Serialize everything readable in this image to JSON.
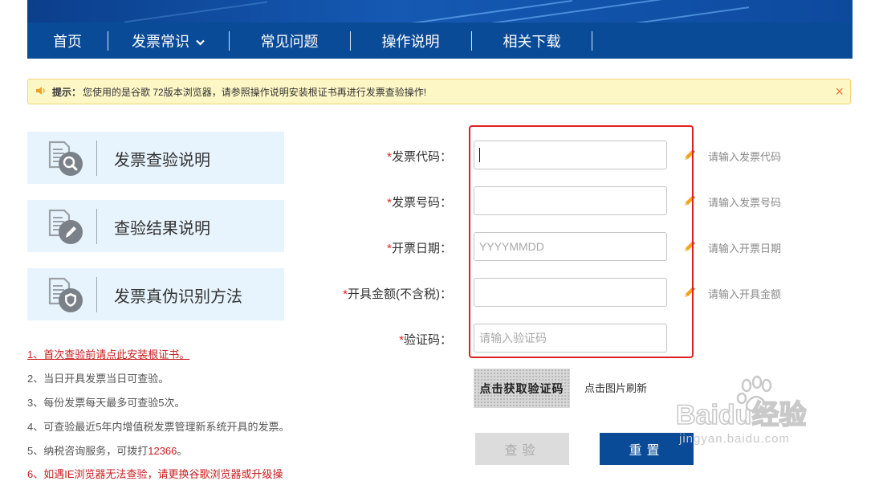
{
  "nav": {
    "items": [
      {
        "label": "首页"
      },
      {
        "label": "发票常识"
      },
      {
        "label": "常见问题"
      },
      {
        "label": "操作说明"
      },
      {
        "label": "相关下载"
      }
    ]
  },
  "notice": {
    "prefix": "提示：",
    "text": "您使用的是谷歌 72版本浏览器，请参照操作说明安装根证书再进行发票查验操作!",
    "close": "×"
  },
  "cards": [
    {
      "label": "发票查验说明",
      "icon": "document-search-icon"
    },
    {
      "label": "查验结果说明",
      "icon": "document-edit-icon"
    },
    {
      "label": "发票真伪识别方法",
      "icon": "document-shield-icon"
    }
  ],
  "tips": {
    "t1": "1、首次查验前请点此安装根证书。",
    "t2": "2、当日开具发票当日可查验。",
    "t3": "3、每份发票每天最多可查验5次。",
    "t4": "4、可查验最近5年内增值税发票管理新系统开具的发票。",
    "t5_prefix": "5、纳税咨询服务，可拨打",
    "t5_phone": "12366",
    "t5_suffix": "。",
    "t6": "6、如遇IE浏览器无法查验，请更换谷歌浏览器或升级操"
  },
  "form": {
    "star": "*",
    "code_label": "发票代码：",
    "code_value": "",
    "code_hint": "请输入发票代码",
    "number_label": "发票号码：",
    "number_value": "",
    "number_hint": "请输入发票号码",
    "date_label": "开票日期：",
    "date_placeholder": "YYYYMMDD",
    "date_hint": "请输入开票日期",
    "amount_label": "开具金额(不含税)：",
    "amount_value": "",
    "amount_hint": "请输入开具金额",
    "captcha_label": "验证码：",
    "captcha_placeholder": "请输入验证码",
    "captcha_image_text": "点击获取验证码",
    "refresh_text": "点击图片刷新",
    "check_button": "查验",
    "reset_button": "重置"
  },
  "watermark": {
    "logo": "Baidu经验",
    "url": "jingyan.baidu.com"
  },
  "colors": {
    "nav_bg": "#0a4b98",
    "notice_bg": "#fdf7c5",
    "card_bg": "#e8f4fd",
    "required_star": "#e02020",
    "highlight_box": "#e02020"
  }
}
